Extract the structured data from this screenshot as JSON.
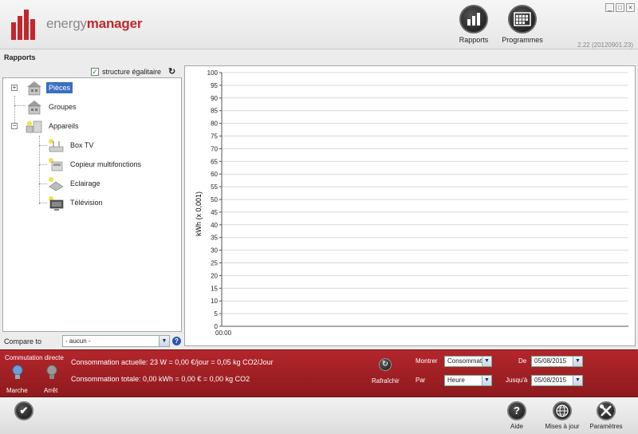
{
  "app": {
    "brand_light": "energy",
    "brand_bold": "manager",
    "version": "2.22 (20120901.23)",
    "accent_color": "#c1272d"
  },
  "window_controls": [
    "_",
    "□",
    "×"
  ],
  "header": {
    "rapports_label": "Rapports",
    "programmes_label": "Programmes"
  },
  "section_title": "Rapports",
  "structure": {
    "checkbox_label": "structure égalitaire",
    "checked": true
  },
  "tree": {
    "items": [
      {
        "label": "Pièces",
        "expander": "+",
        "selected": true,
        "icon": "house-icon"
      },
      {
        "label": "Groupes",
        "icon": "house-icon"
      },
      {
        "label": "Appareils",
        "expander": "−",
        "icon": "devices-icon"
      },
      {
        "label": "Box TV",
        "icon": "box-tv-icon"
      },
      {
        "label": "Copieur multifonctions",
        "icon": "copier-icon"
      },
      {
        "label": "Eclairage",
        "icon": "lamp-icon"
      },
      {
        "label": "Télévision",
        "icon": "tv-icon"
      }
    ]
  },
  "compare": {
    "label": "Compare to",
    "value": "- aucun -"
  },
  "chart_data": {
    "type": "line",
    "title": "",
    "ylabel": "kWh (x 0,001)",
    "xlabel": "",
    "ylim": [
      0,
      100
    ],
    "yticks": [
      0,
      5,
      10,
      15,
      20,
      25,
      30,
      35,
      40,
      45,
      50,
      55,
      60,
      65,
      70,
      75,
      80,
      85,
      90,
      95,
      100
    ],
    "xticks": [
      "00:00"
    ],
    "grid": true,
    "series": []
  },
  "status": {
    "commutation_label": "Commutation directe",
    "marche_label": "Marche",
    "arret_label": "Arrêt",
    "consumption_current": "Consommation actuelle: 23 W = 0,00 €/jour = 0,05 kg CO2/Jour",
    "consumption_total": "Consommation totale: 0,00 kWh = 0,00 € = 0,00 kg CO2",
    "refresh_label": "Rafraîchir",
    "montrer_label": "Montrer",
    "montrer_value": "Consommat",
    "par_label": "Par",
    "par_value": "Heure",
    "de_label": "De",
    "de_value": "05/08/2015",
    "jusqua_label": "Jusqu'à",
    "jusqua_value": "05/08/2015"
  },
  "bottom": {
    "aide_label": "Aide",
    "aide_glyph": "?",
    "maj_label": "Mises à jour",
    "params_label": "Paramètres",
    "check_glyph": "✔"
  }
}
